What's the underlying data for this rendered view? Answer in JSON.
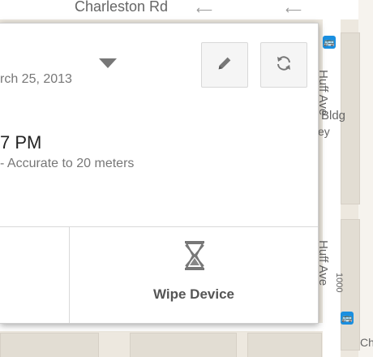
{
  "map": {
    "street_top": "Charleston Rd",
    "street_right_1": "Huff Ave",
    "street_right_2": "Huff Ave",
    "building_label_1": "Bldg",
    "building_label_2": "ey",
    "building_number": "1000",
    "corner_label": "Ch",
    "transit_icon": "transit-icon"
  },
  "card": {
    "date_partial": "rch 25, 2013",
    "time_partial": "7 PM",
    "accuracy_text": "- Accurate to 20 meters",
    "edit_icon": "pencil-icon",
    "refresh_icon": "refresh-icon",
    "wipe_label": "Wipe Device",
    "wipe_icon": "hourglass-icon"
  }
}
